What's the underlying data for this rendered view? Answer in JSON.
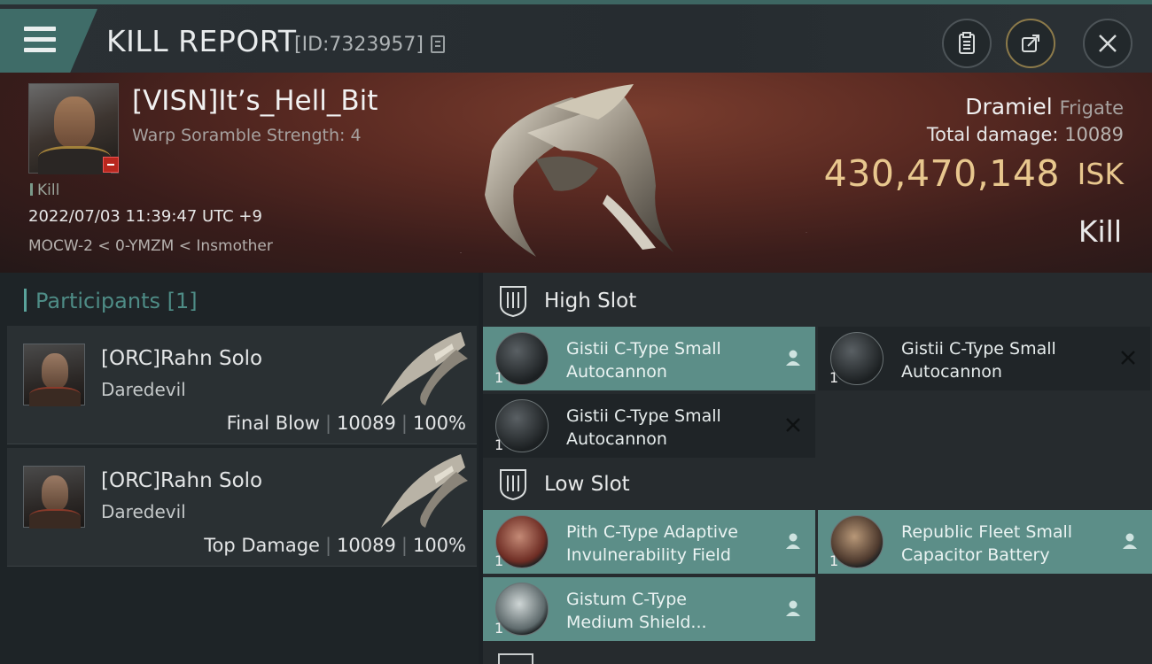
{
  "header": {
    "title": "KILL REPORT",
    "kill_id": "[ID:7323957]"
  },
  "victim": {
    "name": "[VISN]It’s_Hell_Bit",
    "subtitle": "Warp Soramble Strength: 4",
    "tag": "Kill",
    "time": "2022/07/03 11:39:47 UTC +9",
    "location": "MOCW-2 < 0-YMZM < Insmother",
    "ship_name": "Dramiel",
    "ship_class": "Frigate",
    "total_damage_label": "Total damage:",
    "total_damage_value": "10089",
    "isk_value": "430,470,148",
    "isk_unit": "ISK",
    "result": "Kill"
  },
  "participants": {
    "title": "Participants [1]",
    "items": [
      {
        "name": "[ORC]Rahn Solo",
        "ship": "Daredevil",
        "role": "Final Blow",
        "damage": "10089",
        "percent": "100%"
      },
      {
        "name": "[ORC]Rahn Solo",
        "ship": "Daredevil",
        "role": "Top Damage",
        "damage": "10089",
        "percent": "100%"
      }
    ]
  },
  "fitting": {
    "high_slot": {
      "title": "High Slot",
      "modules": [
        {
          "qty": "1",
          "line1": "Gistii C-Type Small",
          "line2": "Autocannon",
          "status": "fitted"
        },
        {
          "qty": "1",
          "line1": "Gistii C-Type Small",
          "line2": "Autocannon",
          "status": "destroyed"
        },
        {
          "qty": "1",
          "line1": "Gistii C-Type Small",
          "line2": "Autocannon",
          "status": "destroyed"
        }
      ]
    },
    "low_slot": {
      "title": "Low Slot",
      "modules": [
        {
          "qty": "1",
          "line1": "Pith C-Type Adaptive",
          "line2": "Invulnerability Field",
          "status": "fitted"
        },
        {
          "qty": "1",
          "line1": "Republic Fleet Small",
          "line2": "Capacitor Battery",
          "status": "fitted"
        },
        {
          "qty": "1",
          "line1": "Gistum C-Type",
          "line2": "Medium Shield...",
          "status": "fitted"
        }
      ]
    }
  },
  "colors": {
    "accent_teal": "#5c8e88",
    "isk_gold": "#e8c78e",
    "header_bar": "#3f6c68"
  }
}
